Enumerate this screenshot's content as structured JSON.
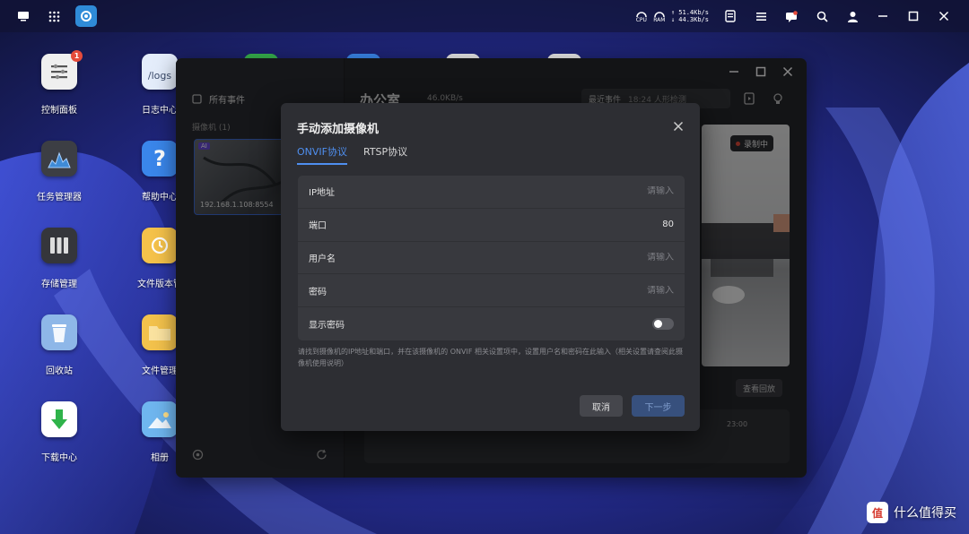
{
  "topbar": {
    "left_icons": [
      "monitor-icon",
      "apps-grid-icon",
      "camera-app-icon"
    ],
    "net_up": "↑ 51.4Kb/s",
    "net_down": "↓ 44.3Kb/s",
    "cpu_label": "CPU",
    "ram_label": "RAM",
    "right_icons": [
      "storage-icon",
      "settings-list-icon",
      "message-icon",
      "search-icon",
      "user-icon",
      "minimize-icon",
      "restore-icon",
      "close-icon"
    ]
  },
  "desktop": {
    "icons": [
      {
        "label": "控制面板",
        "icon": "control-panel-icon",
        "badge": "1",
        "color": "#f1f1f1"
      },
      {
        "label": "任务管理器",
        "icon": "task-manager-icon",
        "color": "#3d3f45"
      },
      {
        "label": "存储管理",
        "icon": "storage-manager-icon",
        "color": "#3a3b40"
      },
      {
        "label": "回收站",
        "icon": "recycle-bin-icon",
        "color": "#8fb8e8"
      },
      {
        "label": "下载中心",
        "icon": "download-center-icon",
        "color": "#ffffff"
      },
      {
        "label": "日志中心",
        "icon": "logs-icon",
        "icon_text": "/logs",
        "color": "#e6eefb"
      },
      {
        "label": "帮助中心",
        "icon": "help-center-icon",
        "icon_text": "?",
        "color": "#3a86ea"
      },
      {
        "label": "文件版本管",
        "icon": "file-version-icon",
        "color": "#f6c34a"
      },
      {
        "label": "文件管理",
        "icon": "file-manager-icon",
        "color": "#f3c24c"
      },
      {
        "label": "相册",
        "icon": "photos-icon",
        "color": "#6fb6ef"
      }
    ]
  },
  "app_window": {
    "sidebar_all_events": "所有事件",
    "sidebar_cameras": "摄像机 (1)",
    "camera_ip": "192.168.1.108:8554",
    "camera_ai_tag": "AI",
    "camera_name": "办公室",
    "bitrate": "46.0KB/s",
    "recent_events": "最近事件",
    "recent_event_time": "18:24 人形检测",
    "recording_label": "录制中",
    "view_playback": "查看回放",
    "timeline_time": "23:00"
  },
  "modal": {
    "title": "手动添加摄像机",
    "tabs": [
      {
        "label": "ONVIF协议",
        "active": true
      },
      {
        "label": "RTSP协议",
        "active": false
      }
    ],
    "fields": {
      "ip_label": "IP地址",
      "ip_placeholder": "请输入",
      "port_label": "端口",
      "port_value": "80",
      "username_label": "用户名",
      "username_placeholder": "请输入",
      "password_label": "密码",
      "password_placeholder": "请输入",
      "show_password_label": "显示密码",
      "show_password_on": false
    },
    "hint": "请找到摄像机的IP地址和端口，并在该摄像机的 ONVIF 相关设置项中，设置用户名和密码在此输入（相关设置请查阅此摄像机使用说明）",
    "cancel_label": "取消",
    "next_label": "下一步"
  },
  "watermark": {
    "badge": "值",
    "text": "什么值得买"
  },
  "colors": {
    "accent": "#4f8ff0",
    "modal_bg": "#2d2e33",
    "field_bg": "#38393e",
    "recording": "#e54b3b"
  }
}
